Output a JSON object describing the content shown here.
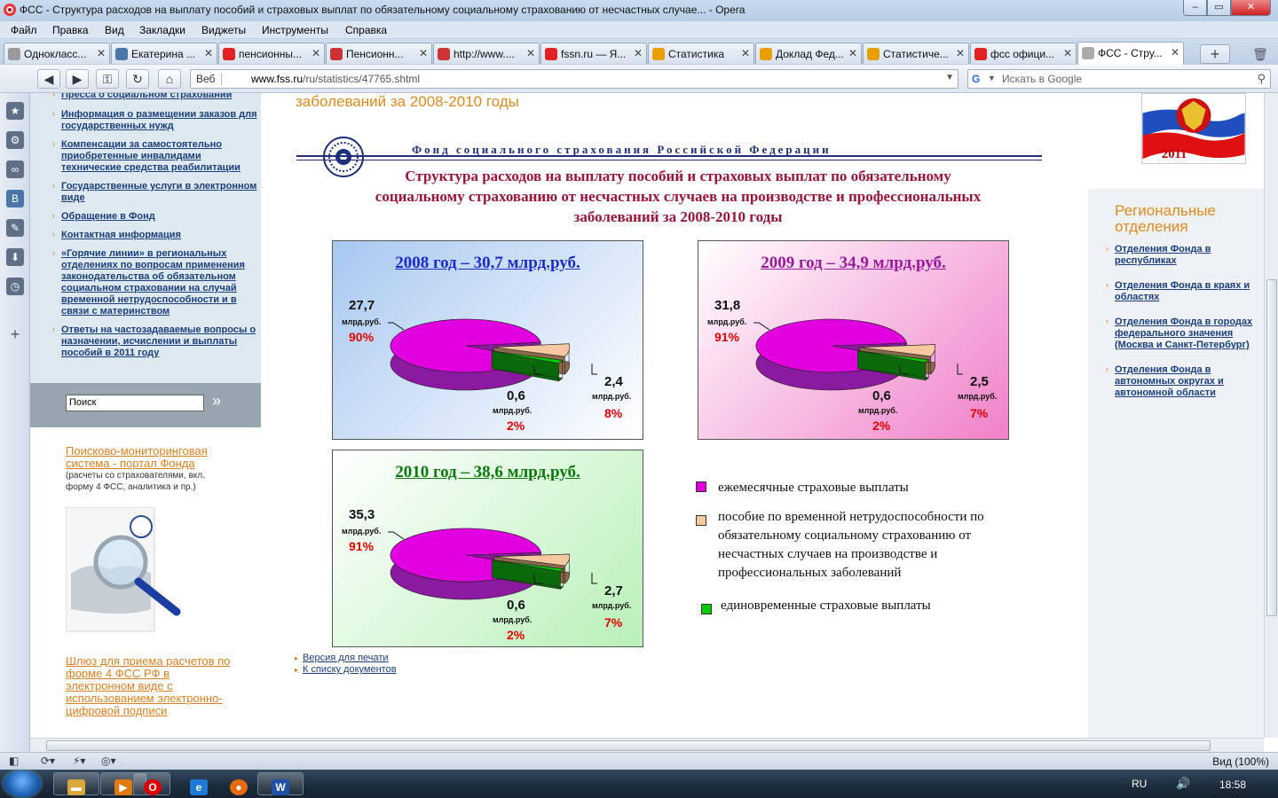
{
  "window": {
    "title": "ФСС - Структура расходов на выплату пособий и страховых выплат по обязательному социальному страхованию от несчастных случае... - Opera"
  },
  "menu": [
    "Файл",
    "Правка",
    "Вид",
    "Закладки",
    "Виджеты",
    "Инструменты",
    "Справка"
  ],
  "tabs": [
    {
      "label": "Однокласс...",
      "icon": "odnoklassniki-icon",
      "color": "#999999"
    },
    {
      "label": "Екатерина ...",
      "icon": "vk-icon",
      "color": "#4a76a8"
    },
    {
      "label": "пенсионны...",
      "icon": "yandex-icon",
      "color": "#e22222"
    },
    {
      "label": "Пенсионн...",
      "icon": "site-icon",
      "color": "#cc3333"
    },
    {
      "label": "http://www....",
      "icon": "site-icon",
      "color": "#cc3333"
    },
    {
      "label": "fssn.ru — Я...",
      "icon": "yandex-icon",
      "color": "#e22222"
    },
    {
      "label": "Статистика",
      "icon": "fss-icon",
      "color": "#e8a000"
    },
    {
      "label": "Доклад Фед...",
      "icon": "fss-icon",
      "color": "#e8a000"
    },
    {
      "label": "Статистиче...",
      "icon": "fss-icon",
      "color": "#e8a000"
    },
    {
      "label": "фсс офици...",
      "icon": "yandex-icon",
      "color": "#e22222"
    },
    {
      "label": "ФСС - Стру...",
      "icon": "page-icon",
      "color": "#aaaaaa"
    }
  ],
  "address": {
    "web_label": "Веб",
    "url_host": "www.fss.ru",
    "url_path": "/ru/statistics/47765.shtml",
    "search_placeholder": "Искать в Google"
  },
  "left_nav": [
    "Пресса о социальном страховании",
    "Информация о размещении заказов для государственных нужд",
    "Компенсации за самостоятельно приобретенные инвалидами технические средства реабилитации",
    "Государственные услуги в электронном виде",
    "Обращение в Фонд",
    "Контактная информация",
    "«Горячие линии» в региональных отделениях по вопросам применения законодательства об обязательном социальном страховании на случай временной нетрудоспособности и в связи с материнством",
    "Ответы на частозадаваемые вопросы о назначении, исчислении и выплаты пособий в 2011 году"
  ],
  "left_search": {
    "value": "Поиск",
    "go": "»"
  },
  "left_cards": {
    "portal_link": "Поисково-мониторинговая система - портал Фонда",
    "portal_desc": "(расчеты со страхователями, вкл. форму 4 ФСС, аналитика и пр.)",
    "gateway_link": "Шлюз для приема расчетов по форме 4 ФСС РФ в электронном виде с использованием электронно-цифровой подписи"
  },
  "main": {
    "page_title": "заболеваний за 2008-2010 годы",
    "fund_name": "Фонд социального страхования Российской Федерации",
    "footer_links": [
      "Версия для печати",
      "К списку документов"
    ]
  },
  "chart_data": {
    "type": "pie",
    "title": "Структура расходов на выплату пособий и страховых выплат по обязательному социальному страхованию от несчастных случаев на производстве и профессиональных заболеваний за 2008-2010 годы",
    "unit": "млрд.руб.",
    "legend": [
      {
        "label": "ежемесячные страховые выплаты",
        "color": "#e000e0"
      },
      {
        "label": "пособие по временной нетрудоспособности по обязательному социальному страхованию от несчастных случаев на производстве и профессиональных заболеваний",
        "color": "#f5c8a0"
      },
      {
        "label": "единовременные страховые  выплаты",
        "color": "#00cc00"
      }
    ],
    "charts": [
      {
        "heading": "2008 год – 30,7 млрд.руб.",
        "heading_color": "#1a2bd0",
        "bg": [
          "#a8c8f0",
          "#ffffff"
        ],
        "slices": [
          {
            "value": 27.7,
            "label": "27,7",
            "pct": "90%"
          },
          {
            "value": 2.4,
            "label": "2,4",
            "pct": "8%"
          },
          {
            "value": 0.6,
            "label": "0,6",
            "pct": "2%"
          }
        ]
      },
      {
        "heading": "2009 год – 34,9 млрд.руб.",
        "heading_color": "#9b1a9b",
        "bg": [
          "#ffffff",
          "#f080c8"
        ],
        "slices": [
          {
            "value": 31.8,
            "label": "31,8",
            "pct": "91%"
          },
          {
            "value": 2.5,
            "label": "2,5",
            "pct": "7%"
          },
          {
            "value": 0.6,
            "label": "0,6",
            "pct": "2%"
          }
        ]
      },
      {
        "heading": "2010 год – 38,6 млрд.руб.",
        "heading_color": "#0a7a0a",
        "bg": [
          "#ffffff",
          "#b8f0b8"
        ],
        "slices": [
          {
            "value": 35.3,
            "label": "35,3",
            "pct": "91%"
          },
          {
            "value": 2.7,
            "label": "2,7",
            "pct": "7%"
          },
          {
            "value": 0.6,
            "label": "0,6",
            "pct": "2%"
          }
        ]
      }
    ]
  },
  "right": {
    "flag_year": "2011",
    "title": "Региональные отделения",
    "links": [
      "Отделения Фонда в республиках",
      "Отделения Фонда в краях и областях",
      "Отделения Фонда в городах федерального значения (Москва и Санкт-Петербург)",
      "Отделения Фонда в автономных округах и автономной области"
    ]
  },
  "status": {
    "zoom": "Вид (100%)"
  },
  "taskbar": {
    "lang": "RU",
    "time": "18:58"
  }
}
